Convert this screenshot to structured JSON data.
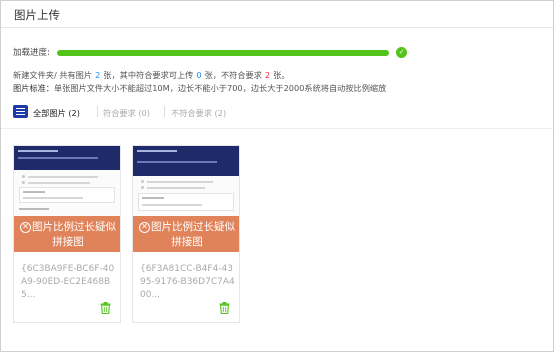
{
  "header": {
    "title": "图片上传"
  },
  "progress": {
    "label": "加载进度:",
    "value": 1.0,
    "color": "#52c41a"
  },
  "stats": {
    "part1": "新建文件夹/ 共有图片",
    "total": "2",
    "part2": "张，其中符合要求可上传",
    "ok": "0",
    "part3": "张，不符合要求",
    "bad": "2",
    "part4": "张。"
  },
  "rules": {
    "label": "图片标准：",
    "text": "单张图片文件大小不能超过10M，边长不能小于700，边长大于2000系统将自动按比例缩放"
  },
  "tabs": [
    {
      "label": "全部图片 (2)"
    },
    {
      "label": "符合要求 (0)"
    },
    {
      "label": "不符合要求 (2)"
    }
  ],
  "cards": [
    {
      "error": "图片比例过长疑似拼接图",
      "name": "{6C3BA9FE-BC6F-40A9-90ED-EC2E468B5..."
    },
    {
      "error": "图片比例过长疑似拼接图",
      "name": "{6F3A81CC-B4F4-4395-9176-B36D7C7A400..."
    }
  ],
  "colors": {
    "accent": "#1890ff",
    "danger": "#f5222d",
    "error_overlay": "#e0835a",
    "success": "#52c41a",
    "trash": "#52c41a"
  },
  "icons": {
    "done": "check-circle-icon",
    "tab": "list-icon",
    "error": "close-circle-icon",
    "delete": "trash-icon"
  }
}
